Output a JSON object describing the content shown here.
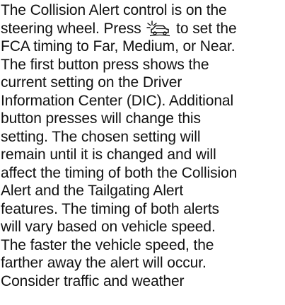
{
  "document": {
    "lines": [
      "The Collision Alert control is on the",
      "steering wheel. Press",
      "to set the",
      "FCA timing to Far, Medium, or Near.",
      "The first button press shows the",
      "current setting on the Driver",
      "Information Center (DIC). Additional",
      "button presses will change this",
      "setting. The chosen setting will",
      "remain until it is changed and will",
      "affect the timing of both the Collision",
      "Alert and the Tailgating Alert",
      "features. The timing of both alerts",
      "will vary based on vehicle speed.",
      "The faster the vehicle speed, the",
      "farther away the alert will occur.",
      "Consider traffic and weather"
    ],
    "inline_icon": "collision-alert-icon",
    "text_color": "#111111",
    "background_color": "#ffffff"
  }
}
